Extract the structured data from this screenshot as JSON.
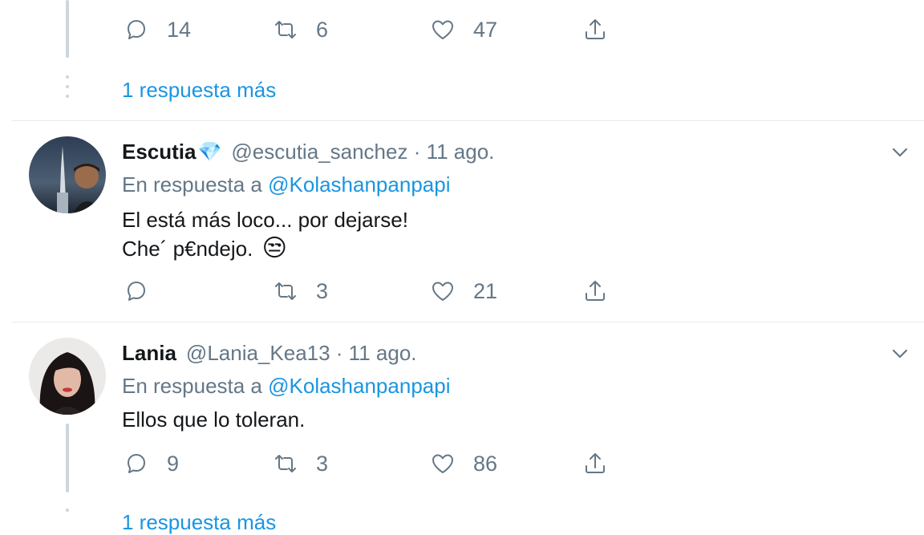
{
  "top_tweet": {
    "actions": {
      "replies": "14",
      "retweets": "6",
      "likes": "47"
    },
    "more_replies": "1 respuesta más"
  },
  "tweet1": {
    "name": "Escutia",
    "name_badge": "💎",
    "handle": "@escutia_sanchez · 11 ago.",
    "reply_prefix": "En respuesta a",
    "reply_mention": "@Kolashanpanpapi",
    "line1": "El está más loco... por dejarse!",
    "line2": "Che´ p€ndejo.",
    "emoji": "😒",
    "actions": {
      "replies": "",
      "retweets": "3",
      "likes": "21"
    }
  },
  "tweet2": {
    "name": "Lania",
    "handle": "@Lania_Kea13 · 11 ago.",
    "reply_prefix": "En respuesta a",
    "reply_mention": "@Kolashanpanpapi",
    "line1": "Ellos que lo toleran.",
    "actions": {
      "replies": "9",
      "retweets": "3",
      "likes": "86"
    },
    "more_replies": "1 respuesta más"
  },
  "icons": [
    "reply-icon",
    "retweet-icon",
    "like-icon",
    "share-icon",
    "chevron-down-icon"
  ],
  "colors": {
    "link": "#1b95e0",
    "muted": "#657786",
    "divider": "#e6ecf0",
    "thread": "#ccd6dd"
  }
}
